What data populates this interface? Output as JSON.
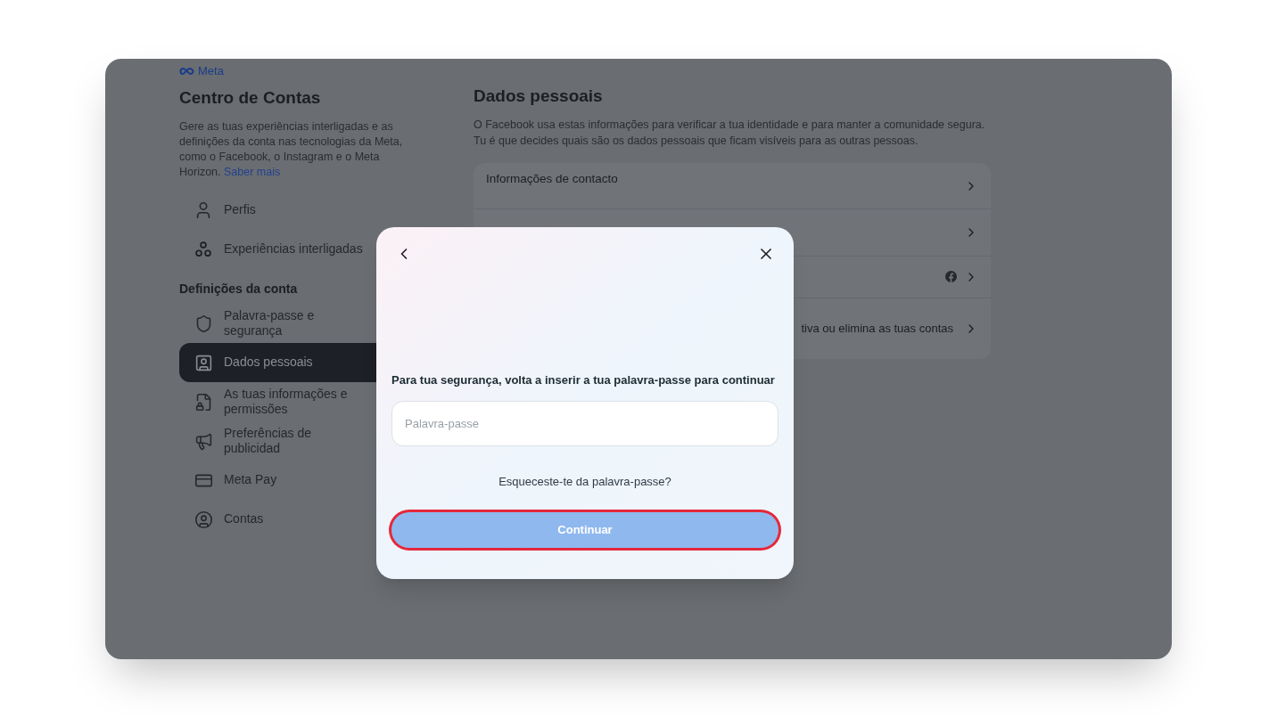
{
  "brand": {
    "name": "Meta"
  },
  "sidebar": {
    "title": "Centro de Contas",
    "description": "Gere as tuas experiências interligadas e as definições da conta nas tecnologias da Meta, como o Facebook, o Instagram e o Meta Horizon.",
    "link": "Saber mais",
    "top_items": [
      {
        "label": "Perfis",
        "selected": false
      },
      {
        "label": "Experiências interligadas",
        "selected": false
      }
    ],
    "section_title": "Definições da conta",
    "account_items": [
      {
        "label": "Palavra-passe e segurança",
        "selected": false
      },
      {
        "label": "Dados pessoais",
        "selected": true
      },
      {
        "label": "As tuas informações e permissões",
        "selected": false
      },
      {
        "label": "Preferências de publicidad",
        "selected": false
      },
      {
        "label": "Meta Pay",
        "selected": false
      },
      {
        "label": "Contas",
        "selected": false
      }
    ]
  },
  "main": {
    "title": "Dados pessoais",
    "description": "O Facebook usa estas informações para verificar a tua identidade e para manter a comunidade segura. Tu é que decides quais são os dados pessoais que ficam visíveis para as outras pessoas.",
    "rows": [
      {
        "kind": "label",
        "label": "Informações de contacto"
      },
      {
        "kind": "blank"
      },
      {
        "kind": "facebook"
      },
      {
        "kind": "trailing",
        "label": "tiva ou elimina as tuas contas"
      }
    ]
  },
  "dialog": {
    "prompt": "Para tua segurança, volta a inserir a tua palavra-passe para continuar",
    "password": {
      "placeholder": "Palavra-passe"
    },
    "forgot_link": "Esqueceste-te da palavra-passe?",
    "continue_button": {
      "label": "Continuar",
      "disabled": true,
      "highlighted": true
    }
  }
}
